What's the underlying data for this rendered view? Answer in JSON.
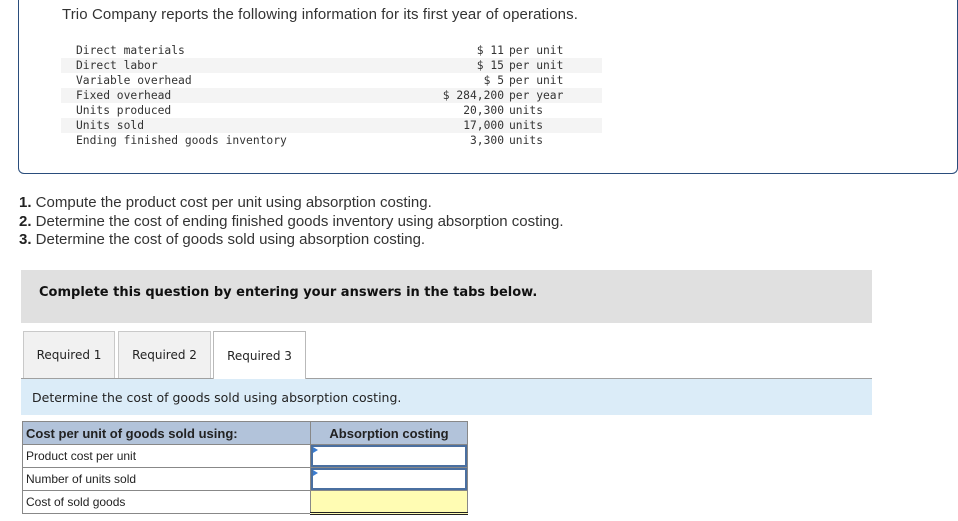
{
  "problem": {
    "intro": "Trio Company reports the following information for its first year of operations.",
    "items": [
      {
        "label": "Direct materials",
        "amount": "$ 11",
        "unit": "per unit"
      },
      {
        "label": "Direct labor",
        "amount": "$ 15",
        "unit": "per unit"
      },
      {
        "label": "Variable overhead",
        "amount": "$ 5",
        "unit": "per unit"
      },
      {
        "label": "Fixed overhead",
        "amount": "$ 284,200",
        "unit": "per year"
      },
      {
        "label": "Units produced",
        "amount": "20,300",
        "unit": "units"
      },
      {
        "label": "Units sold",
        "amount": "17,000",
        "unit": "units"
      },
      {
        "label": "Ending finished goods inventory",
        "amount": "3,300",
        "unit": "units"
      }
    ]
  },
  "questions": [
    {
      "num": "1.",
      "text": " Compute the product cost per unit using absorption costing."
    },
    {
      "num": "2.",
      "text": " Determine the cost of ending finished goods inventory using absorption costing."
    },
    {
      "num": "3.",
      "text": " Determine the cost of goods sold using absorption costing."
    }
  ],
  "instruction": "Complete this question by entering your answers in the tabs below.",
  "tabs": [
    {
      "label": "Required 1",
      "active": false
    },
    {
      "label": "Required 2",
      "active": false
    },
    {
      "label": "Required 3",
      "active": true
    }
  ],
  "panel": {
    "description": "Determine the cost of goods sold using absorption costing.",
    "table": {
      "header_left": "Cost per unit of goods sold using:",
      "header_right": "Absorption costing",
      "rows": [
        {
          "label": "Product cost per unit",
          "value": ""
        },
        {
          "label": "Number of units sold",
          "value": ""
        },
        {
          "label": "Cost of sold goods",
          "value": ""
        }
      ]
    }
  },
  "colors": {
    "header_bg": "#b2c3da",
    "panel_bg": "#dbecf8",
    "calc_cell_bg": "#fffcb3",
    "instruction_bg": "#e0e0e0",
    "box_border": "#2a4d7c"
  }
}
